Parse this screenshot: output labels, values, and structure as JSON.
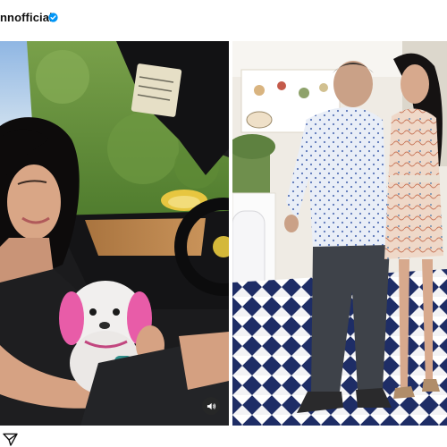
{
  "post": {
    "username": "nnofficial",
    "verified": true,
    "verified_icon": "verified-badge-icon",
    "photos": [
      {
        "description_icon": "photo-woman-in-car-with-pink-eared-dog"
      },
      {
        "description_icon": "photo-couple-in-patterned-store"
      }
    ]
  },
  "controls": {
    "sound_icon": "speaker-icon",
    "share_icon": "send-icon"
  },
  "colors": {
    "verified_blue": "#0095f6",
    "text": "#111111",
    "dog_pink": "#e85ca8",
    "floor_blue": "#1e2d66"
  }
}
